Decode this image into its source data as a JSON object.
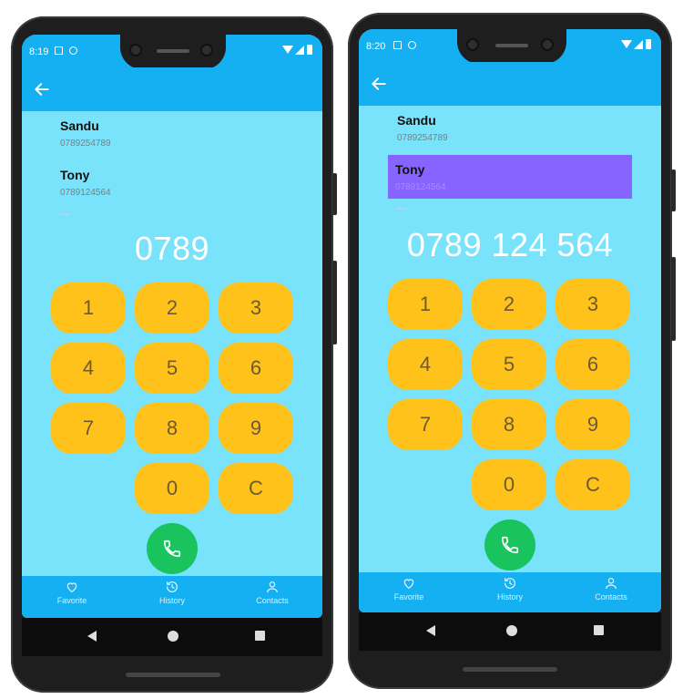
{
  "phones": [
    {
      "status_time": "8:19",
      "contacts": [
        {
          "name": "Sandu",
          "number": "0789254789",
          "selected": false
        },
        {
          "name": "Tony",
          "number": "0789124564",
          "selected": false
        }
      ],
      "display_number": "0789",
      "keypad": [
        "1",
        "2",
        "3",
        "4",
        "5",
        "6",
        "7",
        "8",
        "9",
        "0",
        "C"
      ],
      "bottom_nav": {
        "favorite": "Favorite",
        "history": "History",
        "contacts": "Contacts"
      }
    },
    {
      "status_time": "8:20",
      "contacts": [
        {
          "name": "Sandu",
          "number": "0789254789",
          "selected": false
        },
        {
          "name": "Tony",
          "number": "0789124564",
          "selected": true
        }
      ],
      "display_number": "0789 124 564",
      "keypad": [
        "1",
        "2",
        "3",
        "4",
        "5",
        "6",
        "7",
        "8",
        "9",
        "0",
        "C"
      ],
      "bottom_nav": {
        "favorite": "Favorite",
        "history": "History",
        "contacts": "Contacts"
      }
    }
  ],
  "colors": {
    "app_bar": "#14b0f2",
    "background": "#79e3fb",
    "key": "#ffc21b",
    "key_text": "#6e5a2e",
    "call": "#19c35e",
    "selected_row": "#8763ff"
  },
  "icons": {
    "back": "arrow-left-icon",
    "call": "phone-icon",
    "favorite": "heart-icon",
    "history": "history-icon",
    "contacts": "person-icon"
  }
}
